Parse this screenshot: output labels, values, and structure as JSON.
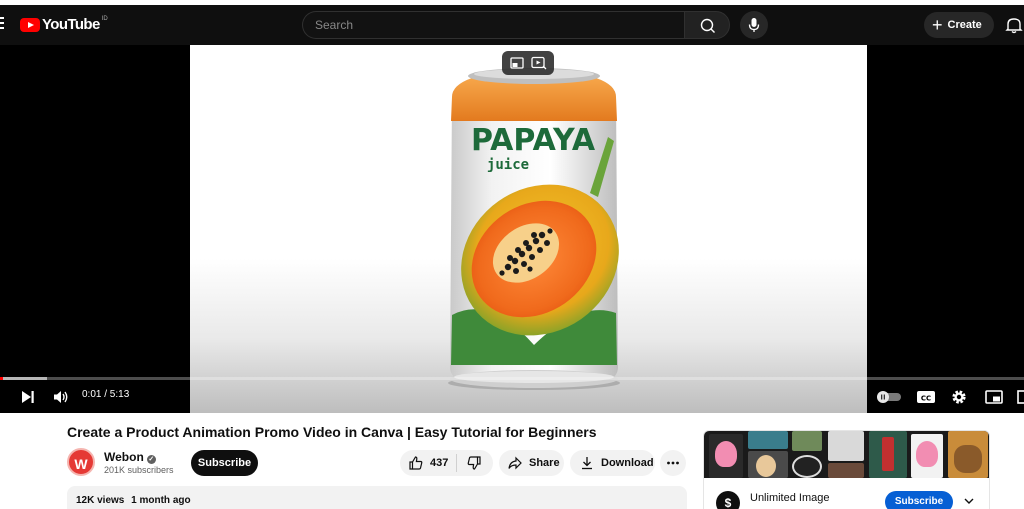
{
  "masthead": {
    "logo_text": "YouTube",
    "region": "ID",
    "search_placeholder": "Search",
    "create_label": "Create"
  },
  "player": {
    "time": "0:01 / 5:13",
    "progress_fraction": 0.003,
    "buffer_fraction": 0.046,
    "product": {
      "brand": "PAPAYA",
      "sub": "juice"
    }
  },
  "video": {
    "title": "Create a Product Animation Promo Video in Canva | Easy Tutorial for Beginners",
    "channel": {
      "avatar_letter": "W",
      "name": "Webon",
      "subscribers": "201K subscribers",
      "subscribe_label": "Subscribe"
    },
    "actions": {
      "likes": "437",
      "share": "Share",
      "download": "Download"
    },
    "meta": {
      "views": "12K views",
      "age": "1 month ago"
    }
  },
  "ad": {
    "logo_letter": "$",
    "name": "Unlimited Image",
    "subscribe_label": "Subscribe"
  },
  "colors": {
    "brand_red": "#ff0000",
    "subscribe_blue": "#065fd4"
  }
}
